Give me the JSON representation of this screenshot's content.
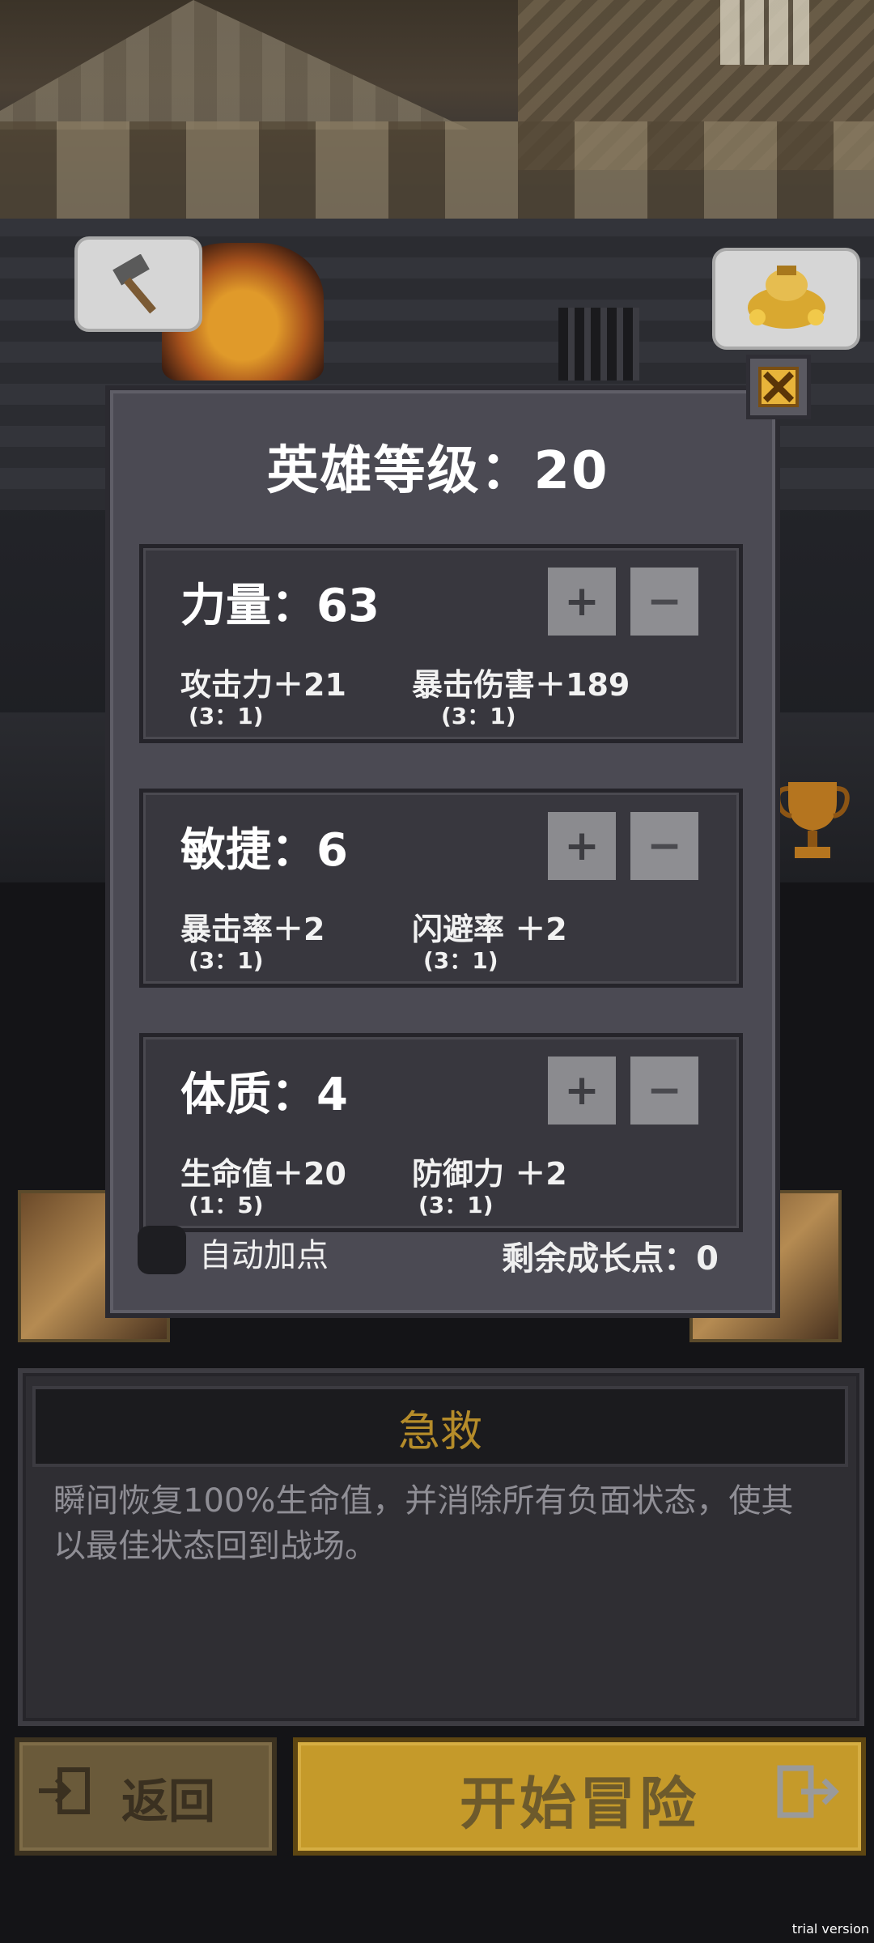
{
  "panel": {
    "title": "英雄等级：20",
    "stats": [
      {
        "name": "力量：63",
        "plus": "+",
        "minus": "−",
        "left": {
          "label": "攻击力＋21",
          "ratio": "(3：1)"
        },
        "right": {
          "label": "暴击伤害＋189",
          "ratio": "(3：1)"
        }
      },
      {
        "name": "敏捷：6",
        "plus": "+",
        "minus": "−",
        "left": {
          "label": "暴击率＋2",
          "ratio": "(3：1)"
        },
        "right": {
          "label": "闪避率 ＋2",
          "ratio": "(3：1)"
        }
      },
      {
        "name": "体质：4",
        "plus": "+",
        "minus": "−",
        "left": {
          "label": "生命值＋20",
          "ratio": "(1：5)"
        },
        "right": {
          "label": "防御力 ＋2",
          "ratio": "(3：1)"
        }
      }
    ],
    "auto_label": "自动加点",
    "remaining": "剩余成长点：0"
  },
  "description": {
    "title": "急救",
    "text": "瞬间恢复100%生命值，并消除所有负面状态，使其以最佳状态回到战场。"
  },
  "buttons": {
    "back": "返回",
    "start": "开始冒险"
  },
  "watermark": "trial version",
  "colors": {
    "accent_gold": "#c59a2a",
    "panel_bg": "#4b4a53",
    "stat_box_bg": "#38373e"
  },
  "icons": [
    "hammer-icon",
    "money-bag-icon",
    "close-icon",
    "trophy-icon",
    "exit-icon",
    "enter-icon"
  ]
}
